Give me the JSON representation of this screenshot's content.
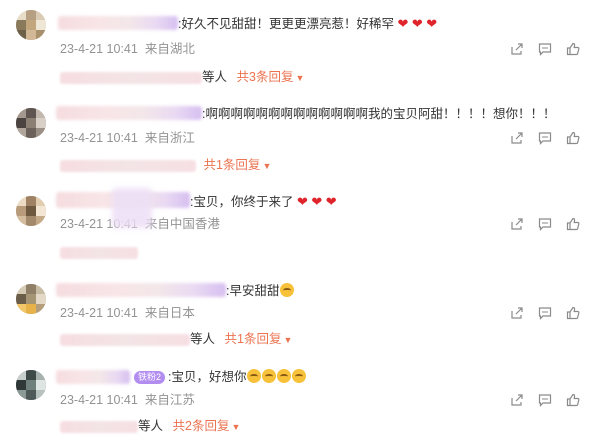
{
  "icons": {
    "share": "share-icon",
    "comment": "comment-icon",
    "like": "like-icon",
    "arrow": "triangle-down-icon"
  },
  "colors": {
    "accent": "#eb7350",
    "meta": "#939393",
    "heart": "#e0242c"
  },
  "comments": [
    {
      "text": ":好久不见甜甜！更更更漂亮惹！好稀罕",
      "hearts": [
        "❤",
        "❤",
        "❤"
      ],
      "time": "23-4-21 10:41",
      "location": "来自湖北",
      "replies": {
        "suffix": "等人",
        "count_label": "共3条回复",
        "arrow": "▼"
      }
    },
    {
      "text": ":啊啊啊啊啊啊啊啊啊啊啊啊啊我的宝贝阿甜！！！！想你！！！",
      "time": "23-4-21 10:41",
      "location": "来自浙江",
      "replies": {
        "count_label": "共1条回复",
        "arrow": "▼"
      }
    },
    {
      "text": ":宝贝，你终于来了",
      "hearts": [
        "❤",
        "❤",
        "❤"
      ],
      "time": "23-4-21 10:41",
      "location": "来自中国香港"
    },
    {
      "text": ":早安甜甜",
      "time": "23-4-21 10:41",
      "location": "来自日本",
      "replies": {
        "suffix": "等人",
        "count_label": "共1条回复",
        "arrow": "▼"
      }
    },
    {
      "badge": "铁粉2",
      "text": ":宝贝，好想你",
      "time": "23-4-21 10:41",
      "location": "来自江苏",
      "replies": {
        "suffix": "等人",
        "count_label": "共2条回复",
        "arrow": "▼"
      }
    }
  ]
}
